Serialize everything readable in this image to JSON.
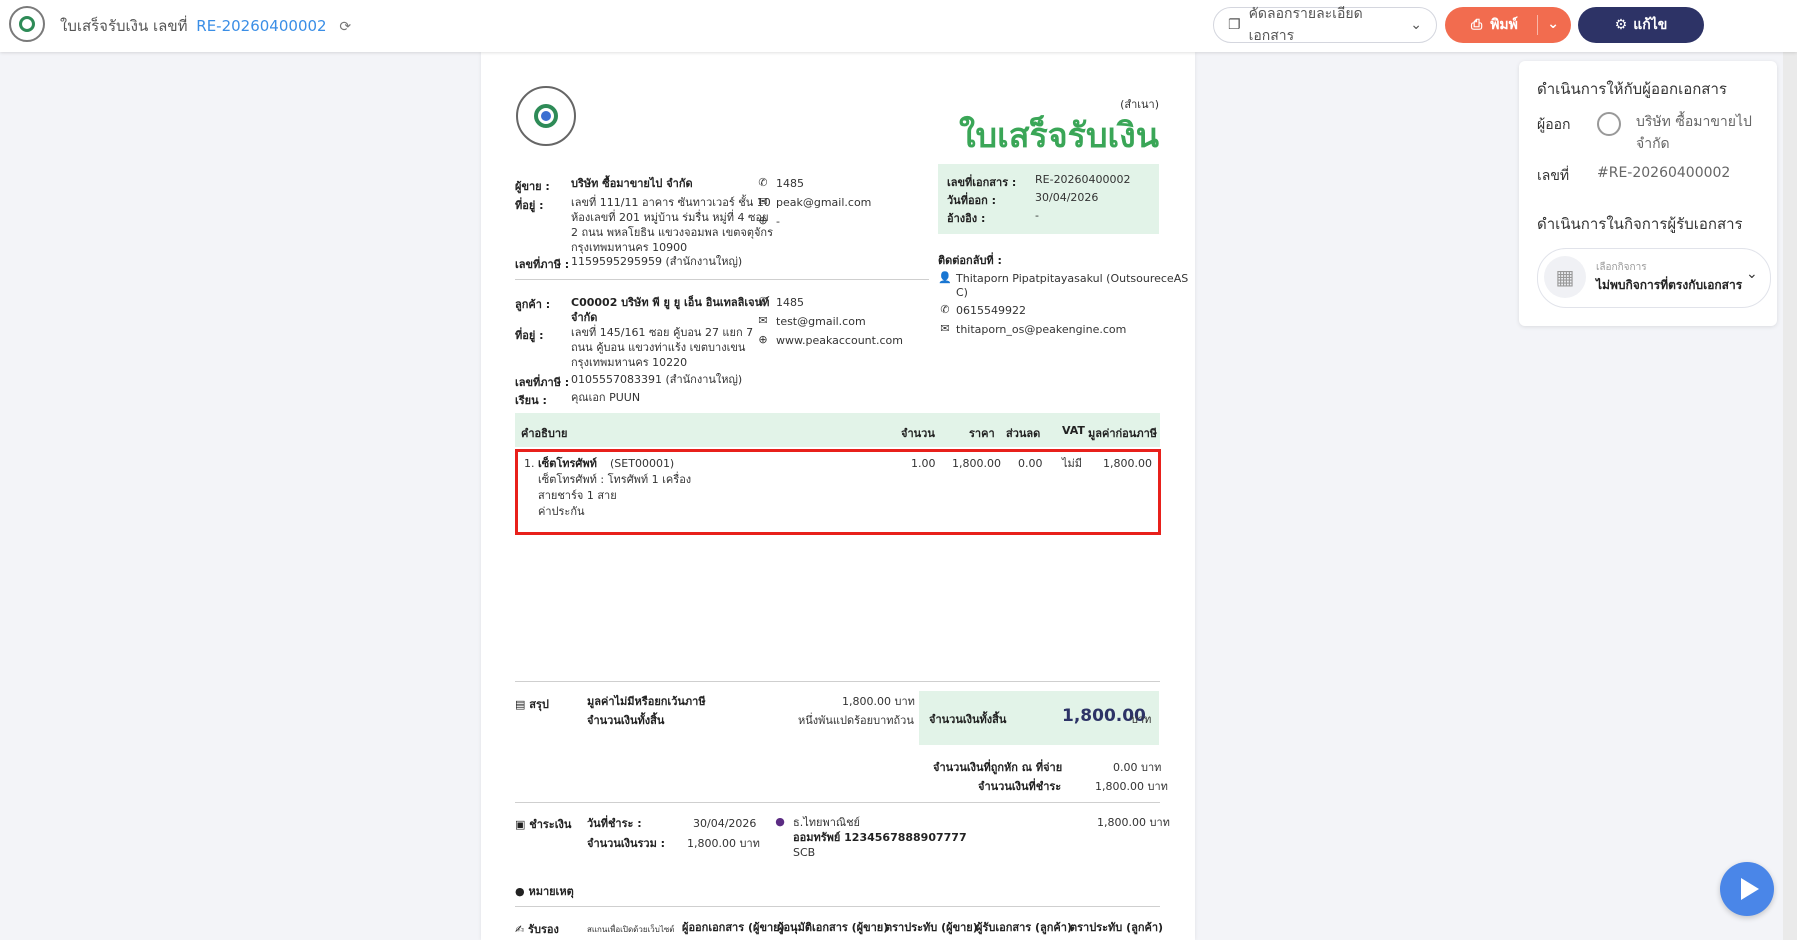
{
  "topbar": {
    "title": "ใบเสร็จรับเงิน เลขที่",
    "doc_number": "RE-20260400002",
    "copy_label": "คัดลอกรายละเอียดเอกสาร",
    "print_label": "พิมพ์",
    "edit_label": "แก้ไข"
  },
  "document": {
    "copy_tag": "(สำเนา)",
    "title": "ใบเสร็จรับเงิน",
    "seller": {
      "label_seller": "ผู้ขาย :",
      "name": "บริษัท ซื้อมาขายไป จำกัด",
      "label_address": "ที่อยู่ :",
      "address": [
        "เลขที่ 111/11 อาคาร ซันทาวเวอร์ ชั้น 10",
        "ห้องเลขที่ 201 หมู่บ้าน ร่มรื่น หมู่ที่ 4 ซอย",
        "2 ถนน พหลโยธิน แขวงจอมพล เขตจตุจักร",
        "กรุงเทพมหานคร 10900"
      ],
      "label_tax": "เลขที่ภาษี :",
      "tax": "1159595295959 (สำนักงานใหญ่)",
      "phone": "1485",
      "email": "peak@gmail.com",
      "web": "-"
    },
    "meta": {
      "doc_no_label": "เลขที่เอกสาร :",
      "doc_no": "RE-20260400002",
      "date_label": "วันที่ออก :",
      "date": "30/04/2026",
      "ref_label": "อ้างอิง :",
      "ref": "-"
    },
    "contact": {
      "label": "ติดต่อกลับที่ :",
      "name_line1": "Thitaporn Pipatpitayasakul (OutsoureceAS",
      "name_line2": "C)",
      "phone": "0615549922",
      "email": "thitaporn_os@peakengine.com"
    },
    "customer": {
      "label_customer": "ลูกค้า :",
      "name_line1": "C00002 บริษัท พี ยู ยู เอ็น อินเทลลิเจนท์",
      "name_line2": "จำกัด",
      "label_address": "ที่อยู่ :",
      "address": [
        "เลขที่ 145/161    ซอย คู้บอน 27 แยก 7",
        "ถนน คู้บอน  แขวงท่าแร้ง เขตบางเขน",
        "กรุงเทพมหานคร 10220"
      ],
      "label_tax": "เลขที่ภาษี :",
      "tax": "0105557083391 (สำนักงานใหญ่)",
      "label_attn": "เรียน :",
      "attn": "คุณเอก PUUN",
      "phone": "1485",
      "email": "test@gmail.com",
      "web": "www.peakaccount.com"
    },
    "table": {
      "headers": {
        "desc": "คำอธิบาย",
        "qty": "จำนวน",
        "price": "ราคา",
        "discount": "ส่วนลด",
        "vat": "VAT",
        "amount": "มูลค่าก่อนภาษี"
      },
      "row": {
        "no": "1.",
        "name": "เซ็ตโทรศัพท์",
        "code": "(SET00001)",
        "desc_lines": [
          "เซ็ตโทรศัพท์ : โทรศัพท์ 1 เครื่อง",
          "สายชาร์จ 1 สาย",
          "ค่าประกัน"
        ],
        "qty": "1.00",
        "price": "1,800.00",
        "discount": "0.00",
        "vat": "ไม่มี",
        "amount": "1,800.00"
      }
    },
    "summary": {
      "label": "สรุป",
      "no_vat_label": "มูลค่าไม่มีหรือยกเว้นภาษี",
      "no_vat_value": "1,800.00 บาท",
      "total_label": "จำนวนเงินทั้งสิ้น",
      "total_words": "หนึ่งพันแปดร้อยบาทถ้วน",
      "box_label": "จำนวนเงินทั้งสิ้น",
      "box_value": "1,800.00",
      "box_unit": "บาท",
      "withheld_label": "จำนวนเงินที่ถูกหัก ณ ที่จ่าย",
      "withheld_value": "0.00 บาท",
      "to_pay_label": "จำนวนเงินที่ชำระ",
      "to_pay_value": "1,800.00 บาท"
    },
    "payment": {
      "label": "ชำระเงิน",
      "date_label": "วันที่ชำระ :",
      "date": "30/04/2026",
      "total_label": "จำนวนเงินรวม :",
      "total": "1,800.00 บาท",
      "bank": "ธ.ไทยพาณิชย์",
      "account": "ออมทรัพย์ 1234567888907777",
      "bank_short": "SCB",
      "amount": "1,800.00 บาท"
    },
    "note_label": "หมายเหตุ",
    "sign": {
      "label": "รับรอง",
      "scan_text": "สแกนเพื่อเปิดด้วยเว็บไซต์",
      "issuer": "ผู้ออกเอกสาร (ผู้ขาย)",
      "approver": "ผู้อนุมัติเอกสาร (ผู้ขาย)",
      "seller_stamp": "ตราประทับ (ผู้ขาย)",
      "receiver": "ผู้รับเอกสาร (ลูกค้า)",
      "customer_stamp": "ตราประทับ (ลูกค้า)"
    }
  },
  "side_panel": {
    "issuer_heading": "ดำเนินการให้กับผู้ออกเอกสาร",
    "issuer_label": "ผู้ออก",
    "issuer_name_line1": "บริษัท ซื้อมาขายไป",
    "issuer_name_line2": "จำกัด",
    "number_label": "เลขที่",
    "number_value": "#RE-20260400002",
    "receiver_heading": "ดำเนินการในกิจการผู้รับเอกสาร",
    "select_label": "เลือกกิจการ",
    "select_value": "ไม่พบกิจการที่ตรงกับเอกสาร"
  },
  "colors": {
    "accent_green": "#3aa657",
    "print_btn": "#f26c4f",
    "edit_btn": "#2d3366",
    "highlight": "#e8201b",
    "light_green": "#e2f3e8"
  }
}
